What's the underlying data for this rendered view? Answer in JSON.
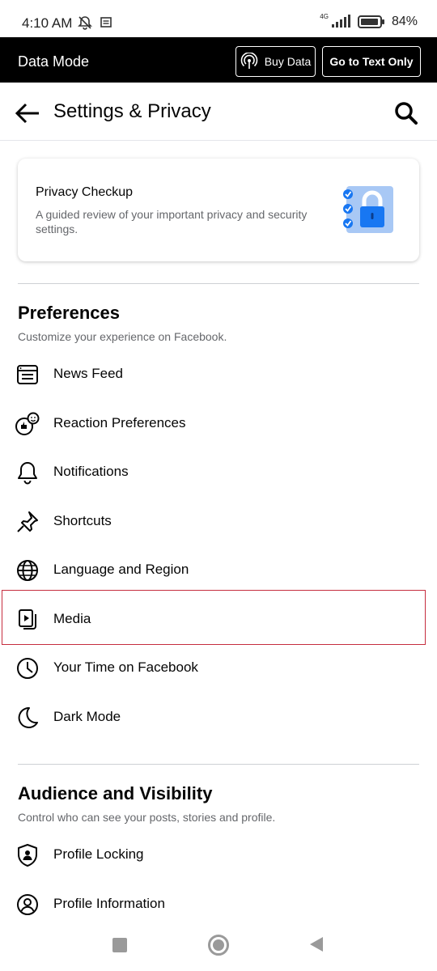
{
  "status_bar": {
    "time": "4:10 AM",
    "network": "4G",
    "battery": "84%"
  },
  "data_mode": {
    "title": "Data Mode",
    "buy_data": "Buy Data",
    "text_only": "Go to Text Only"
  },
  "header": {
    "title": "Settings & Privacy"
  },
  "privacy_card": {
    "title": "Privacy Checkup",
    "description": "A guided review of your important privacy and security settings."
  },
  "preferences": {
    "title": "Preferences",
    "subtitle": "Customize your experience on Facebook.",
    "items": [
      {
        "label": "News Feed",
        "icon": "news-feed-icon"
      },
      {
        "label": "Reaction Preferences",
        "icon": "reaction-icon"
      },
      {
        "label": "Notifications",
        "icon": "bell-icon"
      },
      {
        "label": "Shortcuts",
        "icon": "pin-icon"
      },
      {
        "label": "Language and Region",
        "icon": "globe-icon"
      },
      {
        "label": "Media",
        "icon": "media-icon"
      },
      {
        "label": "Your Time on Facebook",
        "icon": "clock-icon"
      },
      {
        "label": "Dark Mode",
        "icon": "moon-icon"
      }
    ]
  },
  "audience": {
    "title": "Audience and Visibility",
    "subtitle": "Control who can see your posts, stories and profile.",
    "items": [
      {
        "label": "Profile Locking",
        "icon": "shield-person-icon"
      },
      {
        "label": "Profile Information",
        "icon": "profile-icon"
      }
    ]
  },
  "colors": {
    "accent": "#1877f2",
    "highlight": "#c62d3f",
    "data_bar": "#000000"
  }
}
